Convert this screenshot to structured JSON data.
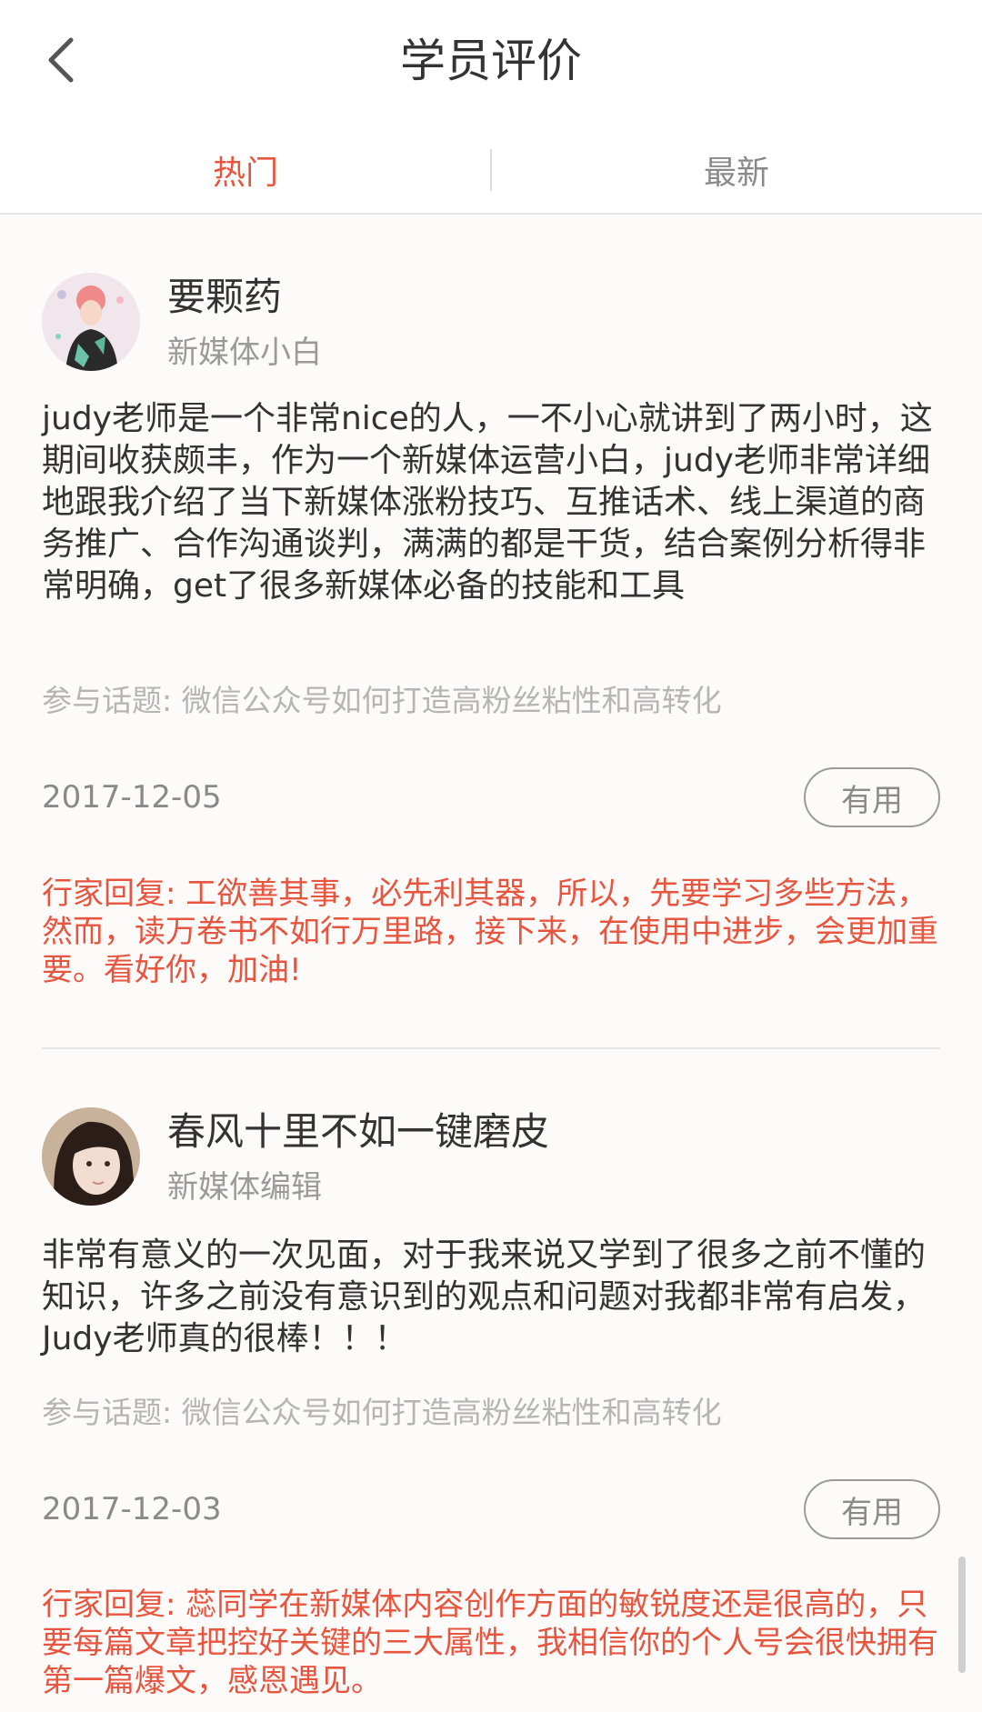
{
  "header": {
    "title": "学员评价",
    "back_icon": "chevron-left-icon"
  },
  "tabs": [
    {
      "label": "热门",
      "active": true
    },
    {
      "label": "最新",
      "active": false
    }
  ],
  "colors": {
    "accent": "#e8553e",
    "text": "#333333",
    "muted": "#8a8a8a"
  },
  "reviews": [
    {
      "username": "要颗药",
      "tag": "新媒体小白",
      "content": "judy老师是一个非常nice的人，一不小心就讲到了两小时，这期间收获颇丰，作为一个新媒体运营小白，judy老师非常详细地跟我介绍了当下新媒体涨粉技巧、互推话术、线上渠道的商务推广、合作沟通谈判，满满的都是干货，结合案例分析得非常明确，get了很多新媒体必备的技能和工具",
      "topic": "参与话题: 微信公众号如何打造高粉丝粘性和高转化",
      "date": "2017-12-05",
      "useful_label": "有用",
      "reply": "行家回复: 工欲善其事，必先利其器，所以，先要学习多些方法，然而，读万卷书不如行万里路，接下来，在使用中进步，会更加重要。看好你，加油!"
    },
    {
      "username": "春风十里不如一键磨皮",
      "tag": "新媒体编辑",
      "content": "非常有意义的一次见面，对于我来说又学到了很多之前不懂的知识，许多之前没有意识到的观点和问题对我都非常有启发，Judy老师真的很棒！！！",
      "topic": "参与话题: 微信公众号如何打造高粉丝粘性和高转化",
      "date": "2017-12-03",
      "useful_label": "有用",
      "reply": "行家回复: 蕊同学在新媒体内容创作方面的敏锐度还是很高的，只要每篇文章把控好关键的三大属性，我相信你的个人号会很快拥有第一篇爆文，感恩遇见。"
    }
  ]
}
